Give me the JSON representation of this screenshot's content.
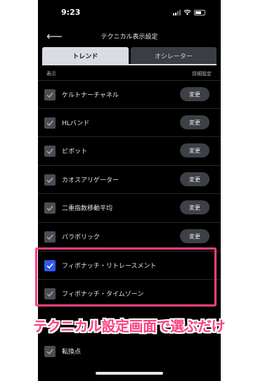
{
  "status_bar": {
    "time": "9:23"
  },
  "nav": {
    "title": "テクニカル表示設定"
  },
  "tabs": [
    {
      "label": "トレンド",
      "active": true
    },
    {
      "label": "オシレーター",
      "active": false
    }
  ],
  "table_header": {
    "show_label": "表示",
    "detail_label": "詳細設定"
  },
  "button_label": "変更",
  "rows": [
    {
      "label": "ケルトナーチャネル",
      "checked": false,
      "has_button": true
    },
    {
      "label": "HLバンド",
      "checked": false,
      "has_button": true
    },
    {
      "label": "ピボット",
      "checked": false,
      "has_button": true
    },
    {
      "label": "カオスアリゲーター",
      "checked": false,
      "has_button": true
    },
    {
      "label": "二重指数移動平均",
      "checked": false,
      "has_button": true
    },
    {
      "label": "パラボリック",
      "checked": false,
      "has_button": true
    },
    {
      "label": "フィボナッチ・リトレースメント",
      "checked": true,
      "has_button": false
    },
    {
      "label": "フィボナッチ・タイムゾーン",
      "checked": false,
      "has_button": false
    },
    {
      "label": "転換点",
      "checked": false,
      "has_button": false
    }
  ],
  "caption": "テクニカル設定画面で選ぶだけ",
  "colors": {
    "accent_pink": "#ff3f83",
    "checkbox_checked": "#2f5bea",
    "checkbox_unchecked": "#4a4d53"
  }
}
